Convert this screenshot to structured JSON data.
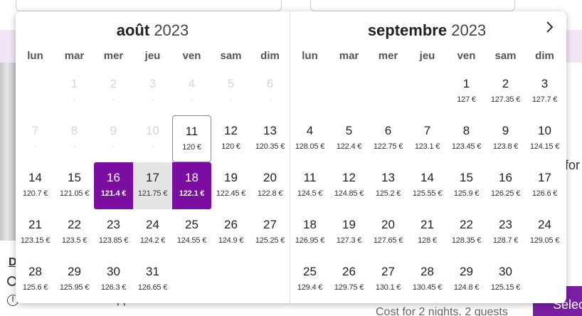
{
  "calendar": {
    "weekdays": [
      "lun",
      "mar",
      "mer",
      "jeu",
      "ven",
      "sam",
      "dim"
    ],
    "next_icon": "chevron-right-icon",
    "months": [
      {
        "name": "août",
        "year": "2023",
        "weeks": [
          [
            null,
            {
              "d": "1",
              "p": "-",
              "dis": true
            },
            {
              "d": "2",
              "p": "-",
              "dis": true
            },
            {
              "d": "3",
              "p": "-",
              "dis": true
            },
            {
              "d": "4",
              "p": "-",
              "dis": true
            },
            {
              "d": "5",
              "p": "-",
              "dis": true
            },
            {
              "d": "6",
              "p": "-",
              "dis": true
            }
          ],
          [
            {
              "d": "7",
              "p": "-",
              "dis": true
            },
            {
              "d": "8",
              "p": "-",
              "dis": true
            },
            {
              "d": "9",
              "p": "-",
              "dis": true
            },
            {
              "d": "10",
              "p": "-",
              "dis": true
            },
            {
              "d": "11",
              "p": "120 €",
              "today": true
            },
            {
              "d": "12",
              "p": "120 €"
            },
            {
              "d": "13",
              "p": "120.35 €"
            }
          ],
          [
            {
              "d": "14",
              "p": "120.7 €"
            },
            {
              "d": "15",
              "p": "121.05 €"
            },
            {
              "d": "16",
              "p": "121.4 €",
              "sel": "first"
            },
            {
              "d": "17",
              "p": "121.75 €",
              "range": true
            },
            {
              "d": "18",
              "p": "122.1 €",
              "sel": "last"
            },
            {
              "d": "19",
              "p": "122.45 €"
            },
            {
              "d": "20",
              "p": "122.8 €"
            }
          ],
          [
            {
              "d": "21",
              "p": "123.15 €"
            },
            {
              "d": "22",
              "p": "123.5 €"
            },
            {
              "d": "23",
              "p": "123.85 €"
            },
            {
              "d": "24",
              "p": "124.2 €"
            },
            {
              "d": "25",
              "p": "124.55 €"
            },
            {
              "d": "26",
              "p": "124.9 €"
            },
            {
              "d": "27",
              "p": "125.25 €"
            }
          ],
          [
            {
              "d": "28",
              "p": "125.6 €"
            },
            {
              "d": "29",
              "p": "125.95 €"
            },
            {
              "d": "30",
              "p": "126.3 €"
            },
            {
              "d": "31",
              "p": "126.65 €"
            },
            null,
            null,
            null
          ]
        ]
      },
      {
        "name": "septembre",
        "year": "2023",
        "weeks": [
          [
            null,
            null,
            null,
            null,
            {
              "d": "1",
              "p": "127 €"
            },
            {
              "d": "2",
              "p": "127.35 €"
            },
            {
              "d": "3",
              "p": "127.7 €"
            }
          ],
          [
            {
              "d": "4",
              "p": "128.05 €"
            },
            {
              "d": "5",
              "p": "122.4 €"
            },
            {
              "d": "6",
              "p": "122.75 €"
            },
            {
              "d": "7",
              "p": "123.1 €"
            },
            {
              "d": "8",
              "p": "123.45 €"
            },
            {
              "d": "9",
              "p": "123.8 €"
            },
            {
              "d": "10",
              "p": "124.15 €"
            }
          ],
          [
            {
              "d": "11",
              "p": "124.5 €"
            },
            {
              "d": "12",
              "p": "124.85 €"
            },
            {
              "d": "13",
              "p": "125.2 €"
            },
            {
              "d": "14",
              "p": "125.55 €"
            },
            {
              "d": "15",
              "p": "125.9 €"
            },
            {
              "d": "16",
              "p": "126.25 €"
            },
            {
              "d": "17",
              "p": "126.6 €"
            }
          ],
          [
            {
              "d": "18",
              "p": "126.95 €"
            },
            {
              "d": "19",
              "p": "127.3 €"
            },
            {
              "d": "20",
              "p": "127.65 €"
            },
            {
              "d": "21",
              "p": "128 €"
            },
            {
              "d": "22",
              "p": "128.35 €"
            },
            {
              "d": "23",
              "p": "128.7 €"
            },
            {
              "d": "24",
              "p": "129.05 €"
            }
          ],
          [
            {
              "d": "25",
              "p": "129.4 €"
            },
            {
              "d": "26",
              "p": "129.75 €"
            },
            {
              "d": "27",
              "p": "130.1 €"
            },
            {
              "d": "28",
              "p": "130.45 €"
            },
            {
              "d": "29",
              "p": "124.8 €"
            },
            {
              "d": "30",
              "p": "125.15 €"
            },
            null
          ]
        ]
      }
    ]
  },
  "background": {
    "partial_heading": "D",
    "partial_side_text": "for",
    "cancellation_text": "Cancellation fee applies",
    "cost_text": "Cost for 2 nights, 2 guests",
    "select_button_label": "Selec",
    "check_icon": "check-circle-icon",
    "info_icon": "info-circle-icon",
    "accent_color": "#7b0ea0",
    "range_color": "#e4e4e4"
  }
}
